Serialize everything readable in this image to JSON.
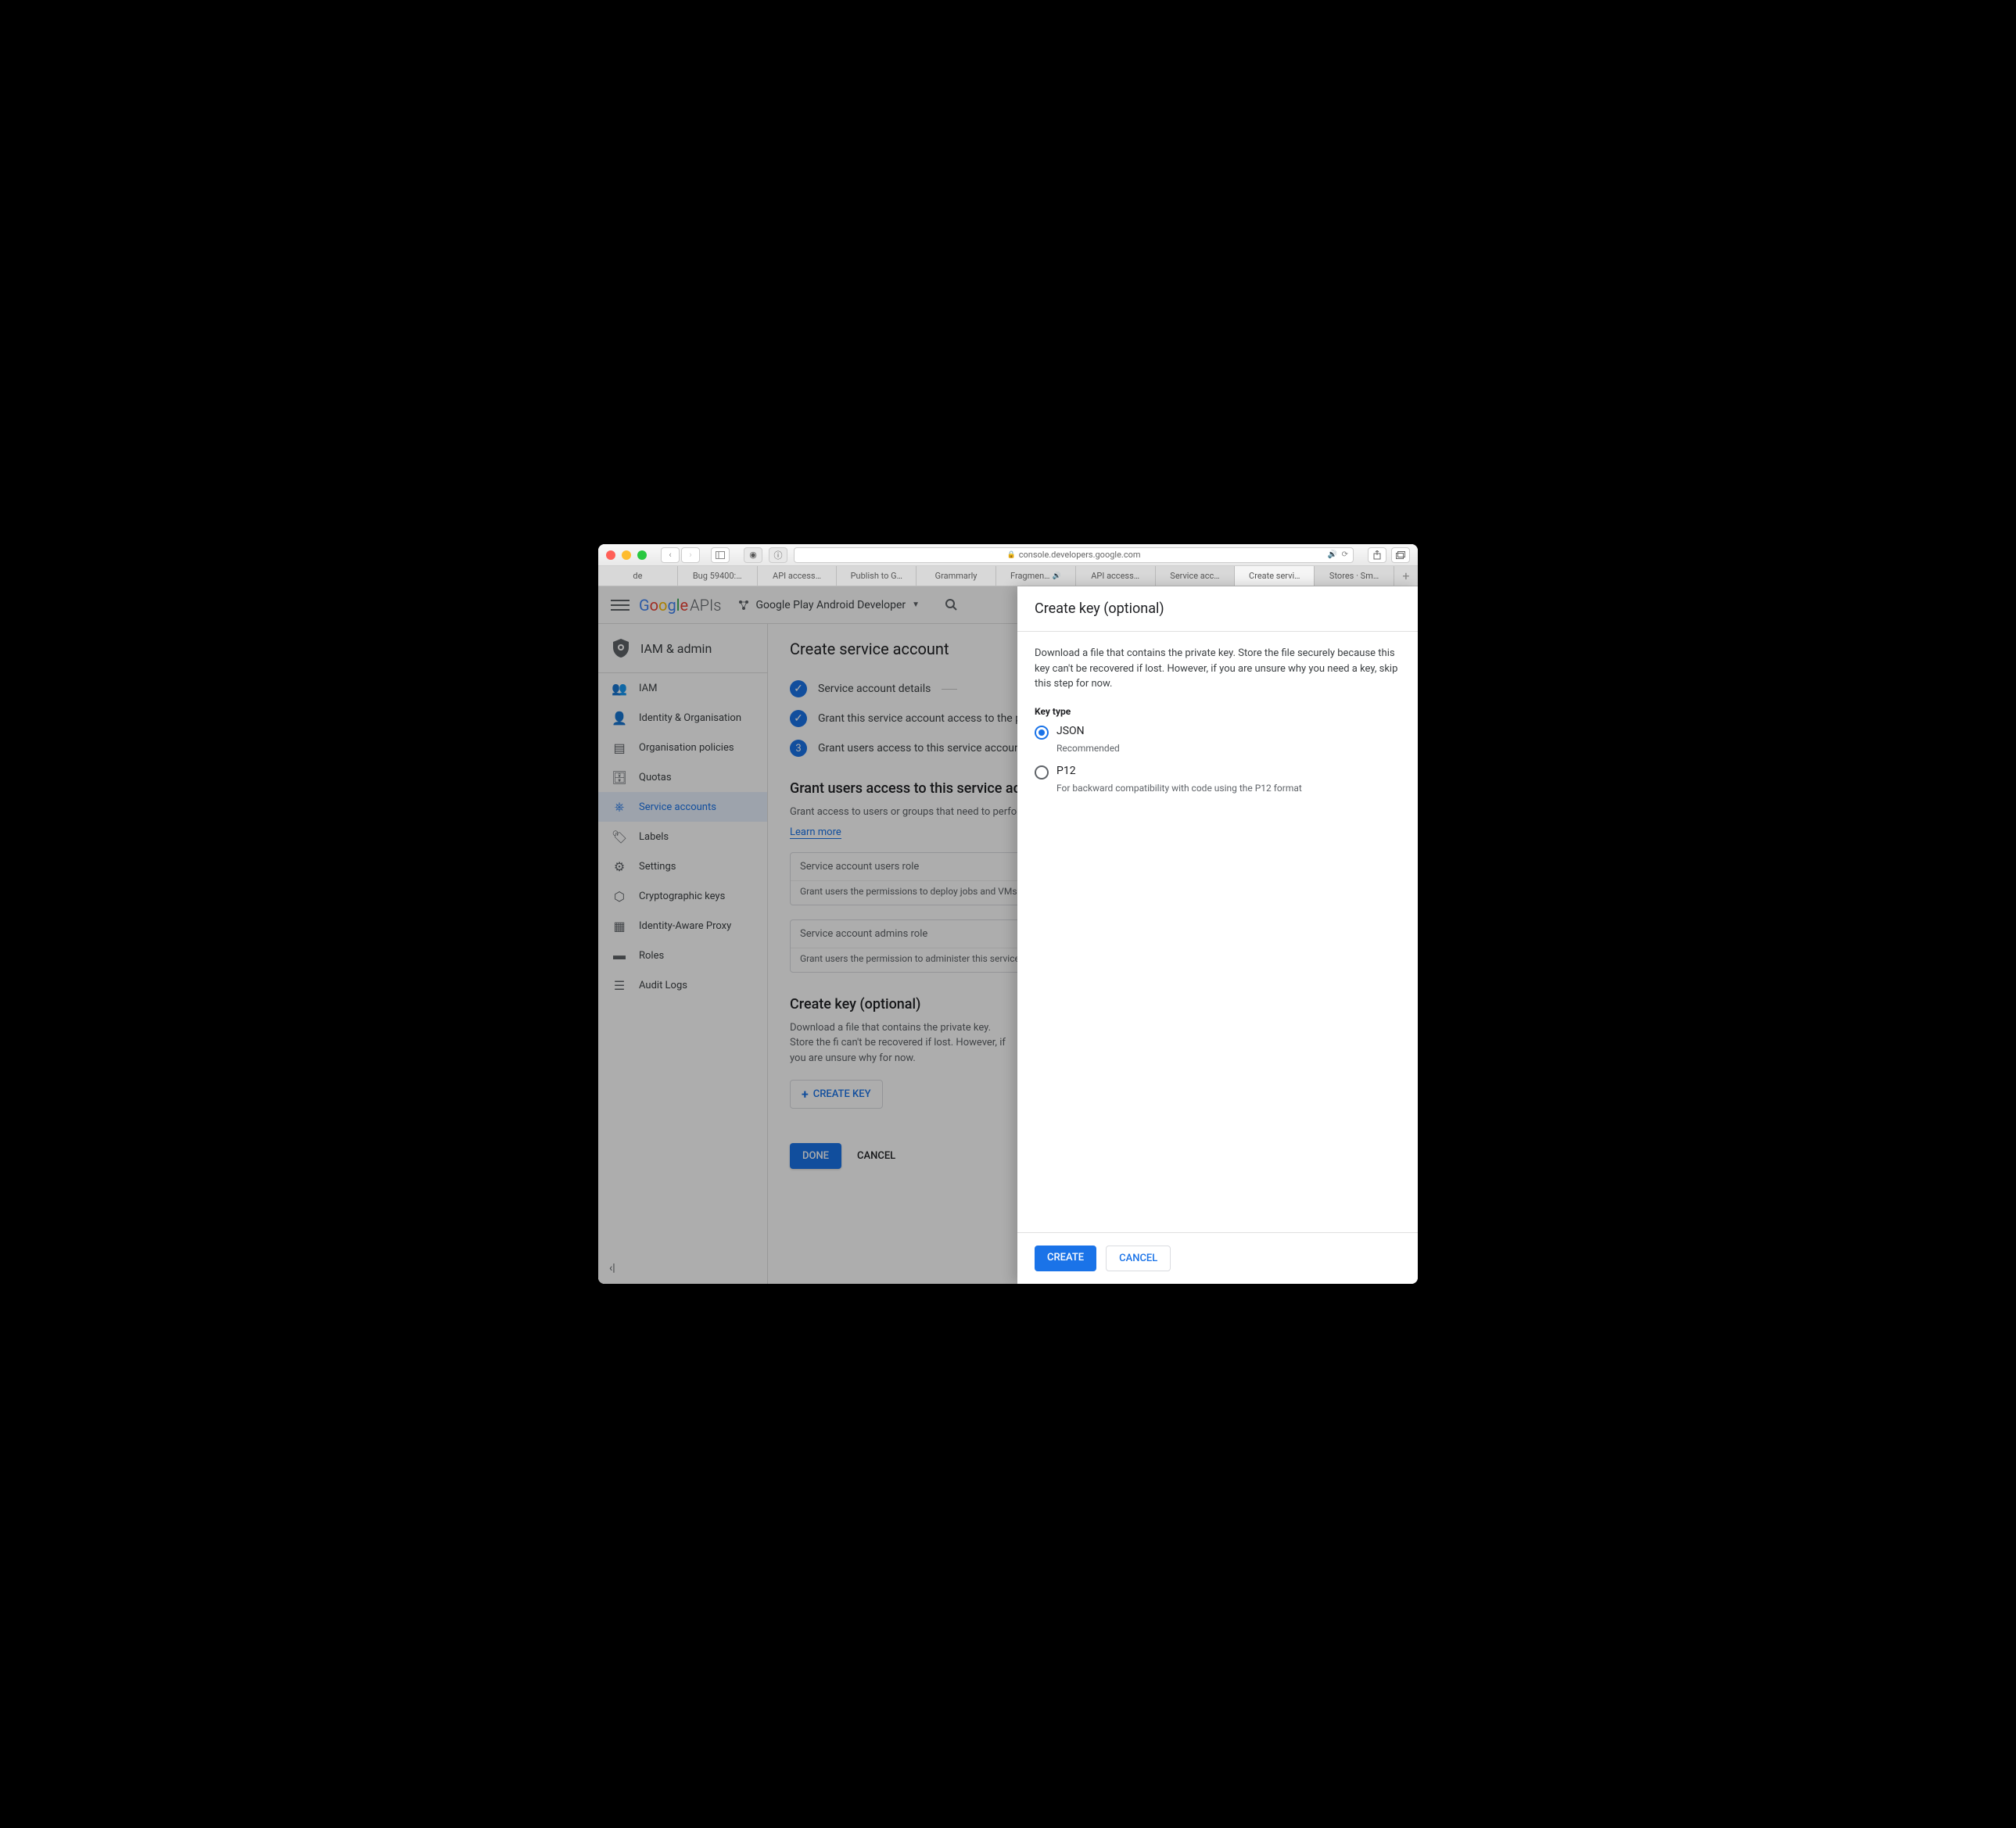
{
  "browser": {
    "url": "console.developers.google.com",
    "tabs": [
      "de",
      "Bug 59400:…",
      "API access…",
      "Publish to G…",
      "Grammarly",
      "Fragmen…",
      "API access…",
      "Service acc…",
      "Create servi…",
      "Stores · Sm…"
    ],
    "active_tab": 8,
    "tab_with_audio": 5
  },
  "header": {
    "logo_text": "Google",
    "logo_suffix": "APIs",
    "project": "Google Play Android Developer"
  },
  "sidebar": {
    "title": "IAM & admin",
    "items": [
      {
        "label": "IAM",
        "icon": "people"
      },
      {
        "label": "Identity & Organisation",
        "icon": "person"
      },
      {
        "label": "Organisation policies",
        "icon": "doc"
      },
      {
        "label": "Quotas",
        "icon": "quota"
      },
      {
        "label": "Service accounts",
        "icon": "service",
        "selected": true
      },
      {
        "label": "Labels",
        "icon": "tag"
      },
      {
        "label": "Settings",
        "icon": "gear"
      },
      {
        "label": "Cryptographic keys",
        "icon": "key"
      },
      {
        "label": "Identity-Aware Proxy",
        "icon": "proxy"
      },
      {
        "label": "Roles",
        "icon": "roles"
      },
      {
        "label": "Audit Logs",
        "icon": "logs"
      }
    ]
  },
  "main": {
    "title": "Create service account",
    "steps": [
      {
        "label": "Service account details",
        "done": true,
        "dash": true
      },
      {
        "label": "Grant this service account access to the pr",
        "done": true
      },
      {
        "label": "Grant users access to this service account",
        "num": "3"
      }
    ],
    "grant_section": {
      "heading": "Grant users access to this service accou",
      "desc": "Grant access to users or groups that need to perform ac",
      "learn": "Learn more",
      "field1_label": "Service account users role",
      "field1_help": "Grant users the permissions to deploy jobs and VMs with th",
      "field2_label": "Service account admins role",
      "field2_help": "Grant users the permission to administer this service acco"
    },
    "key_section": {
      "heading": "Create key (optional)",
      "desc": "Download a file that contains the private key. Store the fi can't be recovered if lost. However, if you are unsure why for now.",
      "button": "CREATE KEY"
    },
    "done": "DONE",
    "cancel": "CANCEL"
  },
  "panel": {
    "title": "Create key (optional)",
    "desc": "Download a file that contains the private key. Store the file securely because this key can't be recovered if lost. However, if you are unsure why you need a key, skip this step for now.",
    "keytype_label": "Key type",
    "options": [
      {
        "label": "JSON",
        "sub": "Recommended",
        "checked": true
      },
      {
        "label": "P12",
        "sub": "For backward compatibility with code using the P12 format",
        "checked": false
      }
    ],
    "create": "CREATE",
    "cancel": "CANCEL"
  }
}
